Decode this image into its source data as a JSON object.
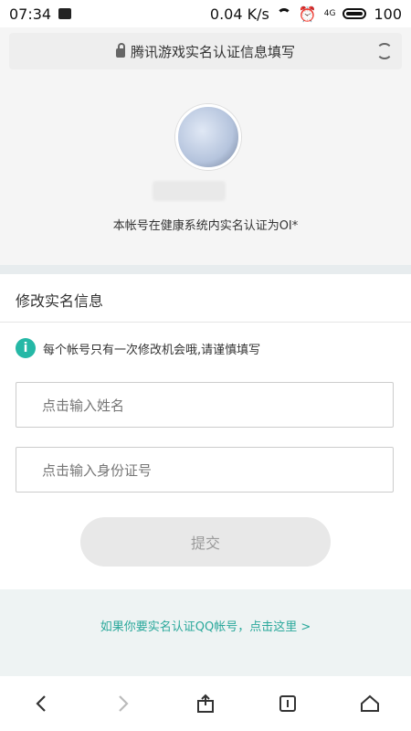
{
  "status_bar": {
    "time": "07:34",
    "network_speed": "0.04 K/s",
    "network_type": "4G",
    "battery": "100"
  },
  "browser": {
    "page_title": "腾讯游戏实名认证信息填写"
  },
  "profile": {
    "verification_text": "本帐号在健康系统内实名认证为OI*"
  },
  "edit_section": {
    "title": "修改实名信息",
    "notice": "每个帐号只有一次修改机会哦,请谨慎填写",
    "name_placeholder": "点击输入姓名",
    "id_placeholder": "点击输入身份证号",
    "submit_label": "提交"
  },
  "footer": {
    "qq_link": "如果你要实名认证QQ帐号，点击这里 >"
  },
  "icons": {
    "status_left": [
      "news-icon"
    ],
    "status_right": [
      "wifi-icon",
      "alarm-icon",
      "battery-icon"
    ],
    "nav": [
      "back-icon",
      "forward-icon",
      "share-icon",
      "tabs-icon",
      "home-icon"
    ]
  },
  "colors": {
    "accent": "#25b8a6",
    "link": "#2aa89b",
    "button_disabled_bg": "#e8e8e8"
  }
}
